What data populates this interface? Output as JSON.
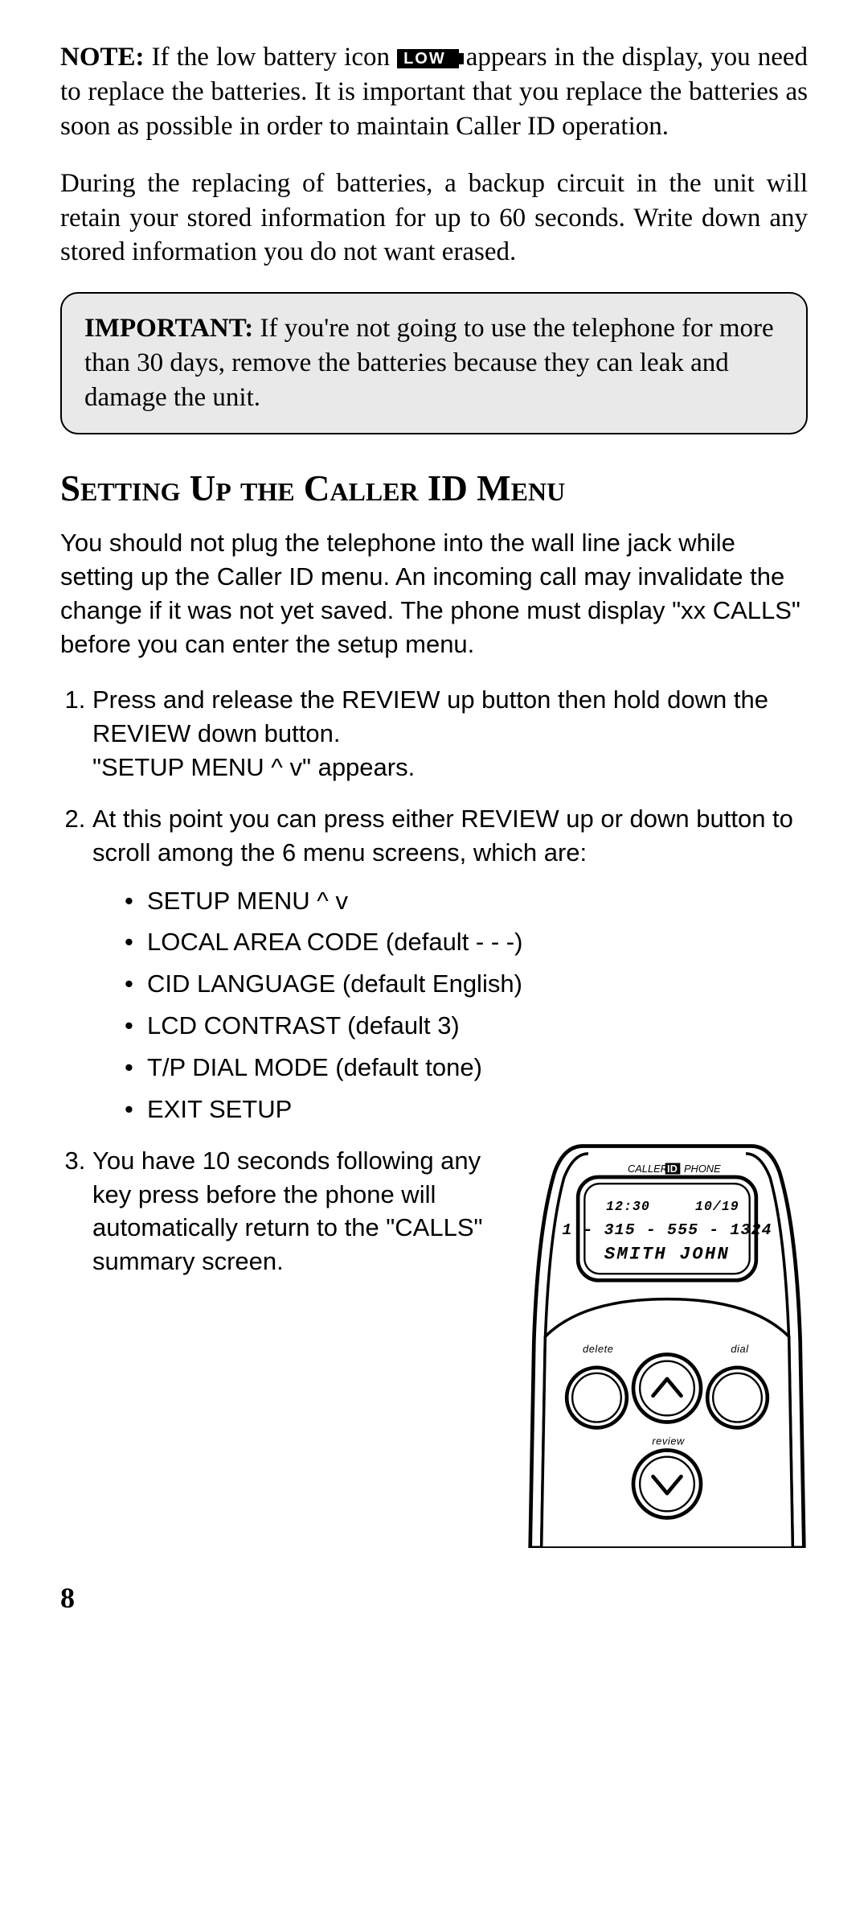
{
  "note_para_prefix": "NOTE:",
  "note_para_before_icon": " If the low battery icon ",
  "low_icon_text": "LOW",
  "note_para_after_icon": " appears in the display, you need to replace the batteries. It is important that you replace the batteries as soon as possible in order to maintain Caller ID operation.",
  "backup_para": "During the replacing of batteries, a backup circuit in the unit will retain your stored information for up to 60 seconds. Write down any stored information you do not want erased.",
  "important_prefix": "IMPORTANT:",
  "important_body": " If you're not going to use the telephone for more than 30 days, remove the batteries because they can leak and damage the unit.",
  "heading": "Setting Up the Caller ID Menu",
  "intro_para": "You should not plug the telephone into the wall line jack while setting up the Caller ID menu. An incoming call may invalidate the change if it was not yet saved. The phone must display \"xx CALLS\" before you can enter the setup menu.",
  "step1_a": "Press and release the REVIEW up button then hold down the REVIEW down button.",
  "step1_b": "\"SETUP MENU ^ v\" appears.",
  "step2_intro": "At this point you can press either REVIEW up or down button to scroll among the 6 menu screens, which are:",
  "menu_items": [
    "SETUP MENU ^ v",
    "LOCAL AREA CODE (default - - -)",
    "CID LANGUAGE (default English)",
    "LCD CONTRAST (default 3)",
    "T/P DIAL MODE (default tone)",
    "EXIT SETUP"
  ],
  "step3": "You have 10 seconds following any key press before the phone will automatically return to the \"CALLS\" summary screen.",
  "page_number": "8",
  "phone": {
    "brand_left": "CALLER",
    "brand_id": "ID",
    "brand_right": "PHONE",
    "lcd_time": "12:30",
    "lcd_date": "10/19",
    "lcd_number": "1 - 315 - 555 - 1324",
    "lcd_name": "SMITH JOHN",
    "btn_delete": "delete",
    "btn_dial": "dial",
    "btn_review": "review"
  }
}
